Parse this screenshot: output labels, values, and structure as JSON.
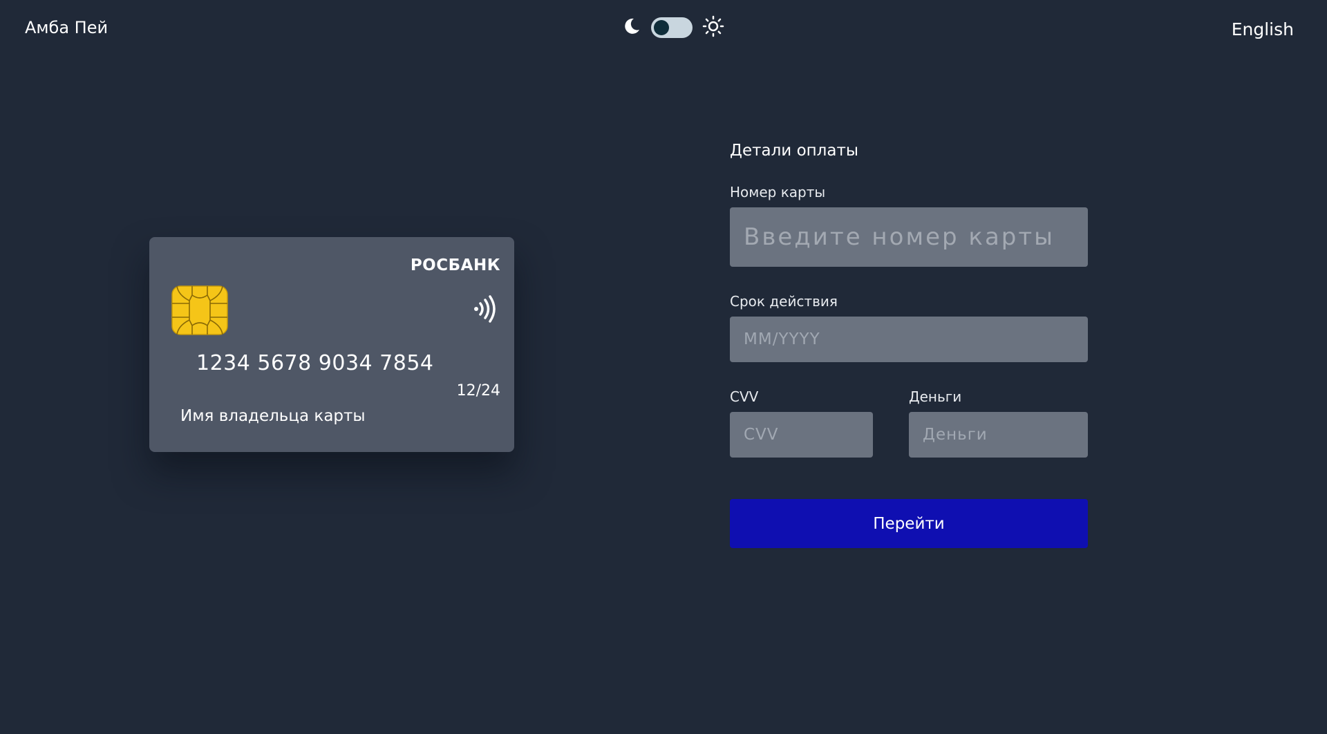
{
  "header": {
    "brand": "Амба Пей",
    "language": "English",
    "theme_toggle": {
      "state": "dark"
    }
  },
  "card": {
    "bank": "РОСБАНК",
    "number": "1234 5678 9034 7854",
    "expiry": "12/24",
    "holder": "Имя владельца карты",
    "chip_color": "#f5c518",
    "background": "#4f5766"
  },
  "form": {
    "title": "Детали оплаты",
    "card_number": {
      "label": "Номер карты",
      "placeholder": "Введите номер карты",
      "value": ""
    },
    "expiry": {
      "label": "Срок действия",
      "placeholder": "MM/YYYY",
      "value": ""
    },
    "cvv": {
      "label": "CVV",
      "placeholder": "CVV",
      "value": ""
    },
    "money": {
      "label": "Деньги",
      "placeholder": "Деньги",
      "value": ""
    },
    "submit_label": "Перейти"
  },
  "colors": {
    "page_background": "#202938",
    "input_background": "#6b7380",
    "button_background": "#0f0fb1"
  }
}
